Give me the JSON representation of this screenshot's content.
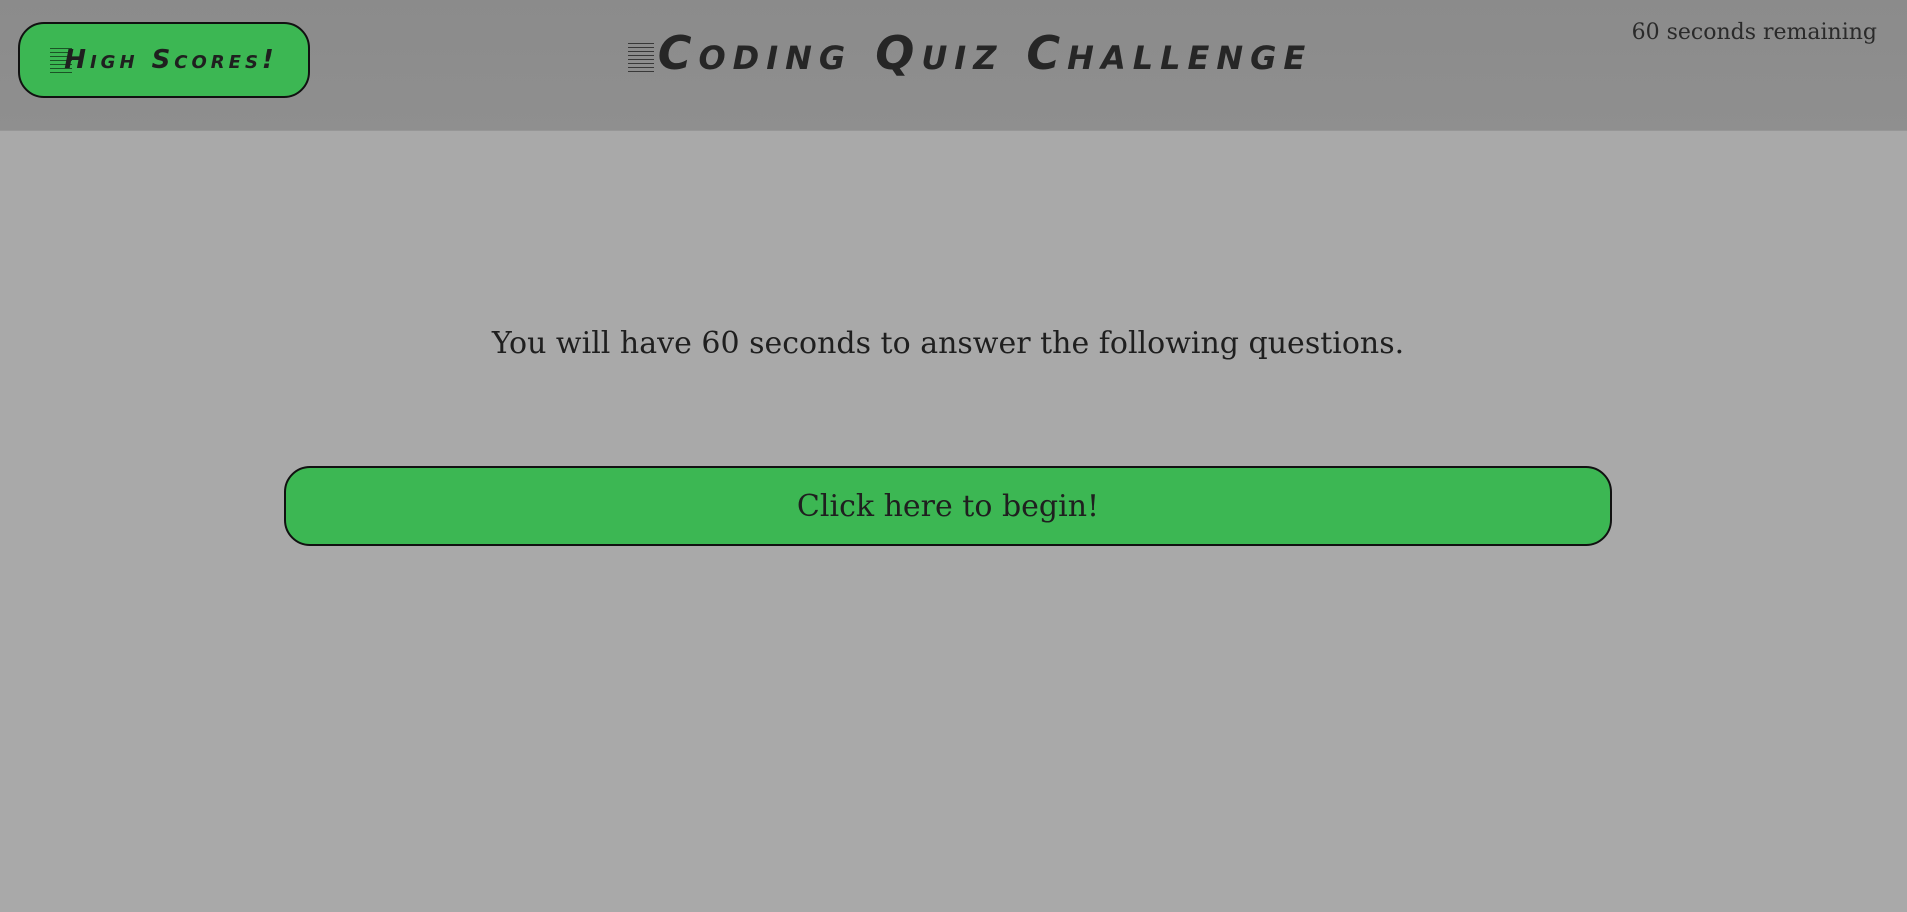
{
  "header": {
    "high_scores_label": "High Scores!",
    "title": "Coding Quiz Challenge",
    "timer_text": "60 seconds remaining"
  },
  "main": {
    "intro_text": "You will have 60 seconds to answer the following questions.",
    "start_button_label": "Click here to begin!"
  },
  "colors": {
    "header_bg": "#8c8c8c",
    "page_bg": "#a9a9a9",
    "button_green": "#3cb753"
  }
}
